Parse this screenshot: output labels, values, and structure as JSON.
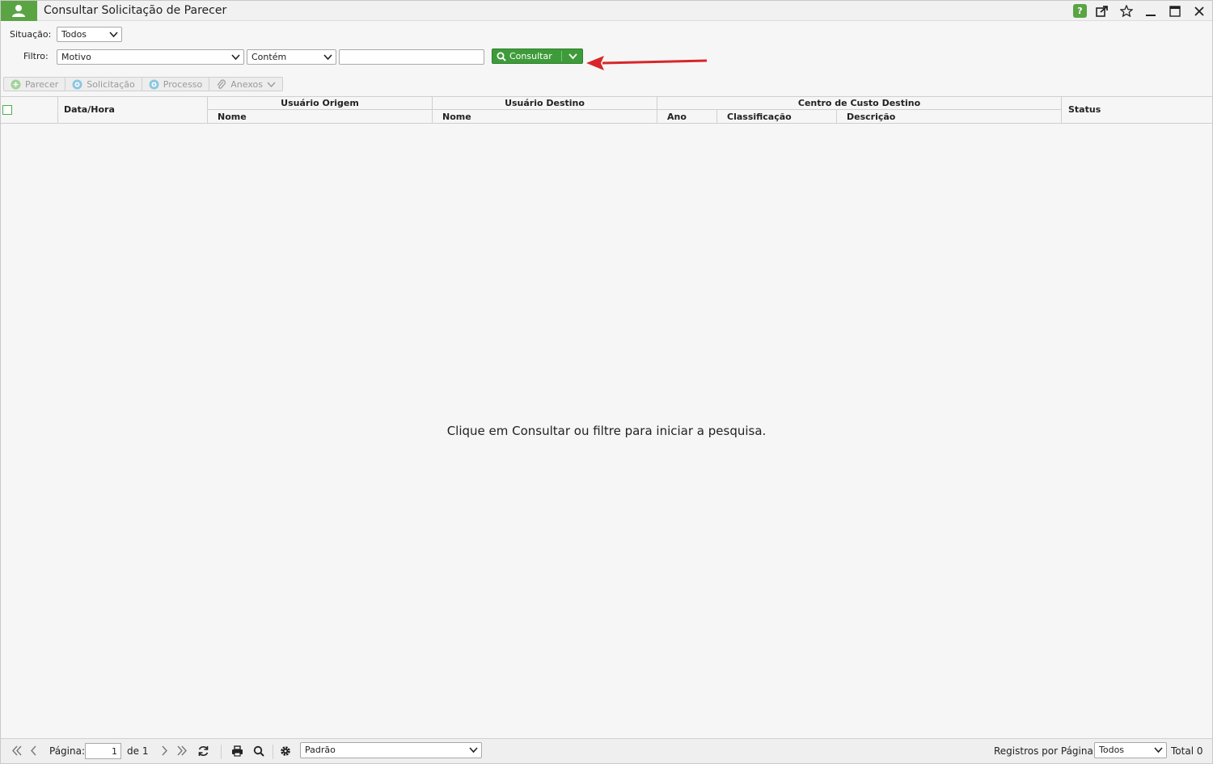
{
  "window": {
    "title": "Consultar Solicitação de Parecer"
  },
  "filters": {
    "situacao_label": "Situação:",
    "situacao_value": "Todos",
    "filtro_label": "Filtro:",
    "field_value": "Motivo",
    "operator_value": "Contém",
    "search_value": "",
    "consultar_label": "Consultar"
  },
  "actions": [
    {
      "label": "Parecer",
      "icon": "plus-circle-icon"
    },
    {
      "label": "Solicitação",
      "icon": "eye-icon"
    },
    {
      "label": "Processo",
      "icon": "eye-icon"
    },
    {
      "label": "Anexos",
      "icon": "paperclip-icon"
    }
  ],
  "grid": {
    "col_datahora": "Data/Hora",
    "group_origem": "Usuário Origem",
    "group_destino": "Usuário Destino",
    "group_centro": "Centro de Custo Destino",
    "col_status": "Status",
    "sub_nome_origem": "Nome",
    "sub_nome_destino": "Nome",
    "sub_ano": "Ano",
    "sub_classificacao": "Classificação",
    "sub_descricao": "Descrição",
    "empty_message": "Clique em Consultar ou filtre para iniciar a pesquisa."
  },
  "pager": {
    "pagina_label": "Página:",
    "page_value": "1",
    "de_label": "de 1",
    "layout_value": "Padrão",
    "registros_label": "Registros por Página:",
    "registros_value": "Todos",
    "total_label": "Total 0"
  },
  "colors": {
    "accent_green": "#5aa444",
    "button_green": "#3e9b3a",
    "annotation_red": "#d8262b"
  }
}
